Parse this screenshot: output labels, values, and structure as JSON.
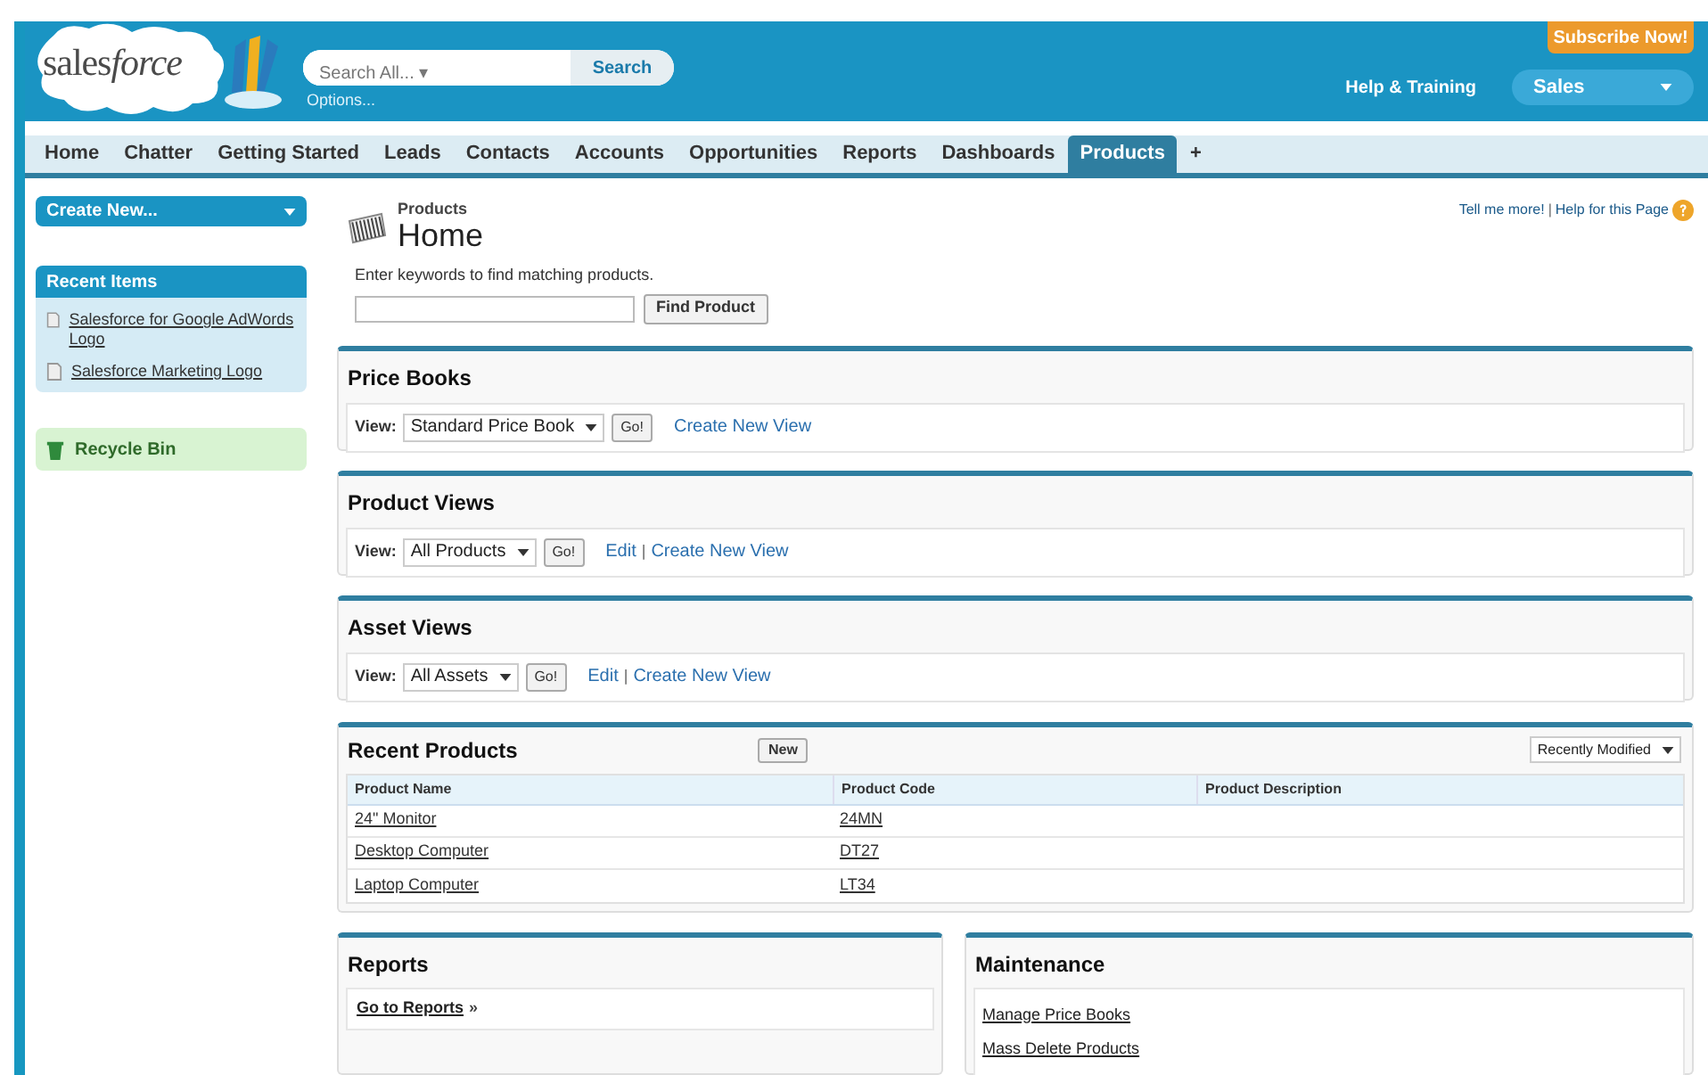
{
  "header": {
    "logo": "sales",
    "logo_italic": "force",
    "search_placeholder": "Search All... ▾",
    "search_button": "Search",
    "options_link": "Options...",
    "subscribe_button": "Subscribe Now!",
    "help_link": "Help & Training",
    "app_menu": "Sales"
  },
  "tabs": [
    {
      "label": "Home",
      "selected": false
    },
    {
      "label": "Chatter",
      "selected": false
    },
    {
      "label": "Getting Started",
      "selected": false
    },
    {
      "label": "Leads",
      "selected": false
    },
    {
      "label": "Contacts",
      "selected": false
    },
    {
      "label": "Accounts",
      "selected": false
    },
    {
      "label": "Opportunities",
      "selected": false
    },
    {
      "label": "Reports",
      "selected": false
    },
    {
      "label": "Dashboards",
      "selected": false
    },
    {
      "label": "Products",
      "selected": true
    },
    {
      "label": "+",
      "selected": false
    }
  ],
  "sidebar": {
    "create_new": "Create New...",
    "recent_items": {
      "title": "Recent Items",
      "items": [
        "Salesforce for Google AdWords Logo",
        "Salesforce Marketing Logo"
      ]
    },
    "recycle_bin": "Recycle Bin"
  },
  "page": {
    "breadcrumb": "Products",
    "title": "Home",
    "help_links": [
      "Tell me more!",
      "Help for this Page"
    ],
    "help_separator": "|",
    "search_hint": "Enter keywords to find matching products.",
    "find_button": "Find Product"
  },
  "view_sections": [
    {
      "title": "Price Books",
      "view_label": "View:",
      "selected_view": "Standard Price Book",
      "go_button": "Go!",
      "links": [
        "Create New View"
      ]
    },
    {
      "title": "Product Views",
      "view_label": "View:",
      "selected_view": "All Products",
      "go_button": "Go!",
      "links": [
        "Edit",
        "Create New View"
      ],
      "separator": "|"
    },
    {
      "title": "Asset Views",
      "view_label": "View:",
      "selected_view": "All Assets",
      "go_button": "Go!",
      "links": [
        "Edit",
        "Create New View"
      ],
      "separator": "|"
    }
  ],
  "recent_products": {
    "title": "Recent Products",
    "new_button": "New",
    "sort": "Recently Modified",
    "columns": [
      "Product Name",
      "Product Code",
      "Product Description"
    ],
    "rows": [
      [
        "24\" Monitor",
        "24MN"
      ],
      [
        "Desktop Computer",
        "DT27"
      ],
      [
        "Laptop Computer",
        "LT34"
      ]
    ]
  },
  "reports": {
    "title": "Reports",
    "link": "Go to Reports",
    "suffix": "»"
  },
  "maintenance": {
    "title": "Maintenance",
    "links": [
      "Manage Price Books",
      "Mass Delete Products"
    ]
  }
}
